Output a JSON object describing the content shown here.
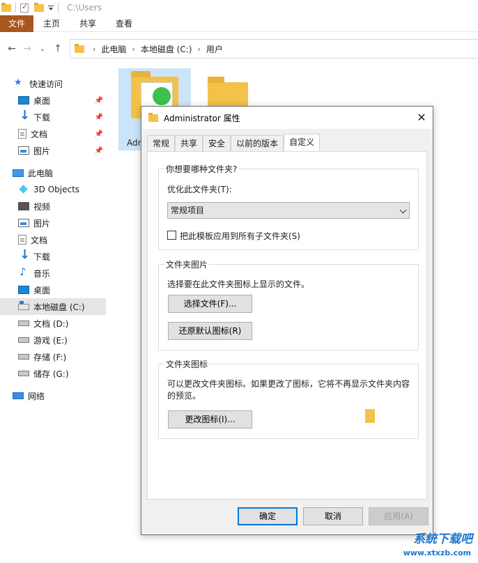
{
  "window": {
    "path_title": "C:\\Users"
  },
  "ribbon": {
    "tabs": [
      "文件",
      "主页",
      "共享",
      "查看"
    ]
  },
  "address": {
    "crumbs": [
      "此电脑",
      "本地磁盘 (C:)",
      "用户"
    ]
  },
  "sidebar": {
    "items": [
      {
        "label": "快速访问",
        "icon": "star-icon"
      },
      {
        "label": "桌面",
        "icon": "desktop-icon",
        "pinned": true
      },
      {
        "label": "下载",
        "icon": "download-icon",
        "pinned": true
      },
      {
        "label": "文档",
        "icon": "document-icon",
        "pinned": true
      },
      {
        "label": "图片",
        "icon": "picture-icon",
        "pinned": true
      },
      {
        "label": "此电脑",
        "icon": "computer-icon"
      },
      {
        "label": "3D Objects",
        "icon": "3d-objects-icon"
      },
      {
        "label": "视频",
        "icon": "video-icon"
      },
      {
        "label": "图片",
        "icon": "picture-icon"
      },
      {
        "label": "文档",
        "icon": "document-icon"
      },
      {
        "label": "下载",
        "icon": "download-icon"
      },
      {
        "label": "音乐",
        "icon": "music-icon"
      },
      {
        "label": "桌面",
        "icon": "desktop-icon"
      },
      {
        "label": "本地磁盘 (C:)",
        "icon": "drive-icon",
        "selected": true
      },
      {
        "label": "文档 (D:)",
        "icon": "drive-icon"
      },
      {
        "label": "游戏 (E:)",
        "icon": "drive-icon"
      },
      {
        "label": "存储 (F:)",
        "icon": "drive-icon"
      },
      {
        "label": "储存 (G:)",
        "icon": "drive-icon"
      },
      {
        "label": "网络",
        "icon": "network-icon"
      }
    ]
  },
  "content": {
    "folder1_label": "Adr"
  },
  "dialog": {
    "title": "Administrator 属性",
    "close": "✕",
    "tabs": [
      "常规",
      "共享",
      "安全",
      "以前的版本",
      "自定义"
    ],
    "active_tab": "自定义",
    "group1": {
      "legend": "你想要哪种文件夹?",
      "optimize_label": "优化此文件夹(T):",
      "optimize_value": "常规项目",
      "apply_sub_label": "把此模板应用到所有子文件夹(S)"
    },
    "group2": {
      "legend": "文件夹图片",
      "desc": "选择要在此文件夹图标上显示的文件。",
      "choose_button": "选择文件(F)...",
      "restore_button": "还原默认图标(R)"
    },
    "group3": {
      "legend": "文件夹图标",
      "desc_line1": "可以更改文件夹图标。如果更改了图标，它将不再显示文件夹内容",
      "desc_line2": "的预览。",
      "change_button": "更改图标(I)..."
    },
    "buttons": {
      "ok": "确定",
      "cancel": "取消",
      "apply": "应用(A)"
    }
  },
  "watermark": {
    "text": "系统下载吧",
    "url": "www.xtxzb.com"
  }
}
